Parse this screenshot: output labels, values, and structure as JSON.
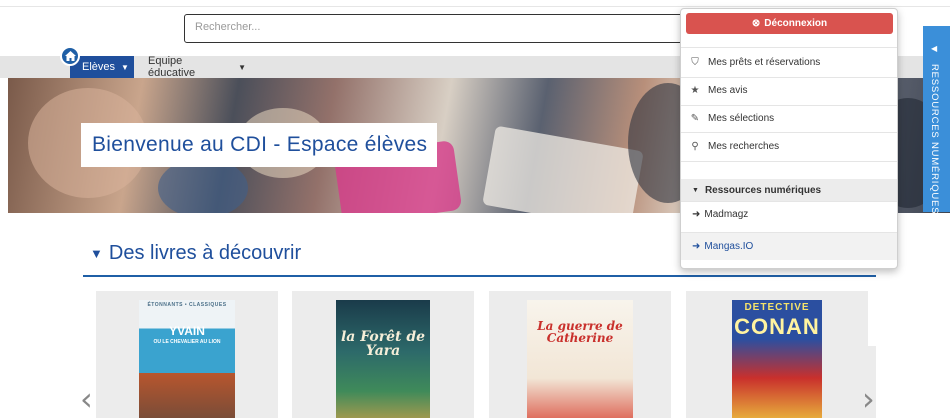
{
  "search": {
    "placeholder": "Rechercher..."
  },
  "nav": {
    "tabs": [
      {
        "label": "Elèves"
      },
      {
        "label": "Equipe éducative"
      }
    ]
  },
  "banner": {
    "welcome": "Bienvenue au CDI - Espace élèves"
  },
  "section": {
    "title": "Des livres à découvrir"
  },
  "books": [
    {
      "series": "ÉTONNANTS • CLASSIQUES",
      "title": "YVAIN",
      "subtitle": "OU LE CHEVALIER AU LION"
    },
    {
      "title": "la Forêt de Yara"
    },
    {
      "title": "La guerre de Catherine"
    },
    {
      "series": "DETECTIVE",
      "title": "CONAN"
    }
  ],
  "user_menu": {
    "logout_label": "Déconnexion",
    "items": [
      {
        "label": "Mes prêts et réservations",
        "icon": "tags-icon"
      },
      {
        "label": "Mes avis",
        "icon": "star-icon"
      },
      {
        "label": "Mes sélections",
        "icon": "pin-icon"
      },
      {
        "label": "Mes recherches",
        "icon": "search-icon"
      }
    ],
    "group_label": "Ressources numériques",
    "resources": [
      {
        "label": "Madmagz"
      },
      {
        "label": "Mangas.IO"
      }
    ]
  },
  "side_tab": {
    "label": "RESSOURCES NUMÉRIQUES"
  },
  "colors": {
    "primary": "#1f4f9c",
    "danger": "#d9534f",
    "side_tab": "#3b8fd9"
  }
}
